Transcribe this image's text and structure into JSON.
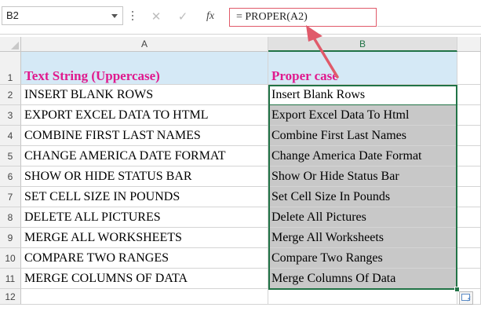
{
  "formula_bar": {
    "name_box": "B2",
    "cancel_icon": "✕",
    "enter_icon": "✓",
    "fx_label": "fx",
    "formula": "= PROPER(A2)"
  },
  "columns": [
    "A",
    "B"
  ],
  "rows": [
    {
      "num": "1",
      "a": "Text String (Uppercase)",
      "b": "Proper case"
    },
    {
      "num": "2",
      "a": "INSERT BLANK ROWS",
      "b": "Insert Blank Rows"
    },
    {
      "num": "3",
      "a": "EXPORT EXCEL DATA TO HTML",
      "b": "Export Excel Data To Html"
    },
    {
      "num": "4",
      "a": "COMBINE FIRST LAST NAMES",
      "b": "Combine First Last Names"
    },
    {
      "num": "5",
      "a": "CHANGE AMERICA DATE FORMAT",
      "b": "Change America Date Format"
    },
    {
      "num": "6",
      "a": "SHOW OR HIDE STATUS BAR",
      "b": "Show Or Hide Status Bar"
    },
    {
      "num": "7",
      "a": "SET CELL SIZE IN POUNDS",
      "b": "Set Cell Size In Pounds"
    },
    {
      "num": "8",
      "a": "DELETE ALL PICTURES",
      "b": "Delete All Pictures"
    },
    {
      "num": "9",
      "a": "MERGE ALL WORKSHEETS",
      "b": "Merge All Worksheets"
    },
    {
      "num": "10",
      "a": "COMPARE TWO RANGES",
      "b": "Compare Two Ranges"
    },
    {
      "num": "11",
      "a": "MERGE COLUMNS OF DATA",
      "b": "Merge Columns Of Data"
    },
    {
      "num": "12",
      "a": "",
      "b": ""
    }
  ],
  "colors": {
    "header_text": "#e0198d",
    "header_fill": "#d5e9f6",
    "selection_green": "#217346",
    "selected_fill": "#c8c8c8",
    "annotation_arrow": "#e05a6a"
  },
  "icons": {
    "name_box_dropdown": "chevron-down-icon",
    "quick_analysis": "quick-analysis-icon",
    "callout": "arrow-icon"
  }
}
